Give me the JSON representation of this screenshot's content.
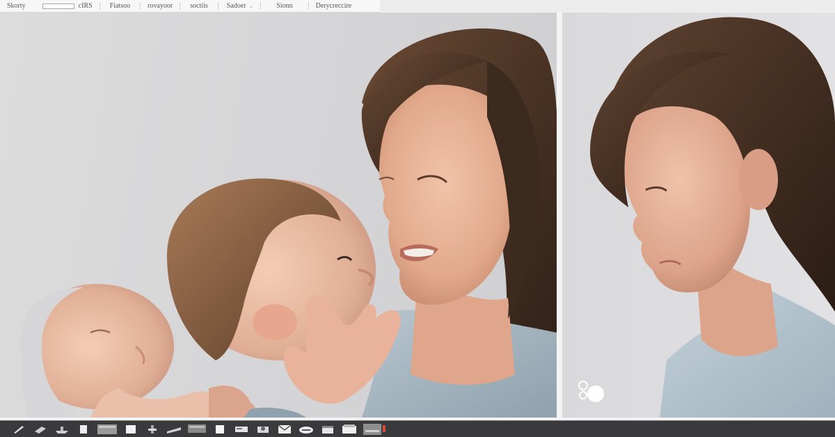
{
  "menubar": {
    "items": [
      {
        "label": "Skorty"
      },
      {
        "label": "cIRS"
      },
      {
        "label": "Fiatsoo"
      },
      {
        "label": "rovayoor"
      },
      {
        "label": "soctiis"
      },
      {
        "label": "Sadoer"
      },
      {
        "label": "Sionn"
      },
      {
        "label": "Derycreccire"
      }
    ]
  },
  "watermark_icon": "camera-badge-icon",
  "taskbar": {
    "icons": [
      "pen-icon",
      "plug-icon",
      "ship-icon",
      "file-icon",
      "window-icon",
      "document-icon",
      "tool-icon",
      "ruler-icon",
      "monitor-icon",
      "page-icon",
      "drive-icon",
      "mail-icon",
      "cloud-icon",
      "calendar-icon",
      "folder-icon",
      "app-icon"
    ]
  },
  "colors": {
    "menubar_bg": "#f7f7f7",
    "taskbar_bg": "#3a3a3c",
    "accent_red": "#e0483c"
  }
}
